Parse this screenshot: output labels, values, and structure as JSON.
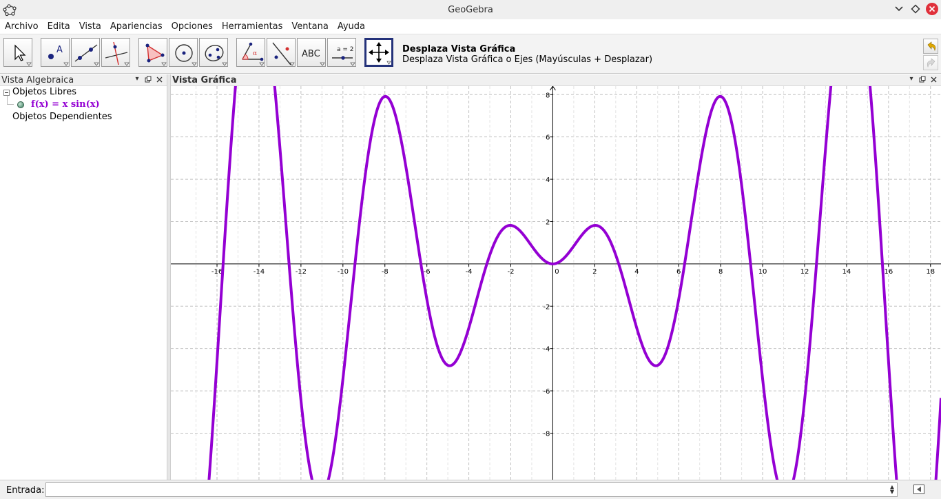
{
  "window": {
    "title": "GeoGebra"
  },
  "menu": [
    {
      "label": "Archivo"
    },
    {
      "label": "Edita"
    },
    {
      "label": "Vista"
    },
    {
      "label": "Apariencias"
    },
    {
      "label": "Opciones"
    },
    {
      "label": "Herramientas"
    },
    {
      "label": "Ventana"
    },
    {
      "label": "Ayuda"
    }
  ],
  "toolbar": {
    "tools": [
      {
        "name": "move-tool",
        "icon": "arrow-pointer-icon"
      },
      {
        "name": "point-tool",
        "icon": "point-icon"
      },
      {
        "name": "line-tool",
        "icon": "line-icon"
      },
      {
        "name": "perpendicular-tool",
        "icon": "perpendicular-icon"
      },
      {
        "name": "polygon-tool",
        "icon": "polygon-icon"
      },
      {
        "name": "circle-tool",
        "icon": "circle-icon"
      },
      {
        "name": "ellipse-tool",
        "icon": "ellipse-icon"
      },
      {
        "name": "angle-tool",
        "icon": "angle-icon"
      },
      {
        "name": "reflect-tool",
        "icon": "reflect-icon"
      },
      {
        "name": "text-tool",
        "icon": "text-icon",
        "label": "ABC"
      },
      {
        "name": "slider-tool",
        "icon": "slider-icon",
        "label": "a = 2"
      },
      {
        "name": "move-graphics-view-tool",
        "icon": "move-view-icon",
        "active": true
      }
    ],
    "active_tool_title": "Desplaza Vista Gráfica",
    "active_tool_desc": "Desplaza Vista Gráfica o Ejes (Mayúsculas + Desplazar)"
  },
  "algebra_view": {
    "title": "Vista Algebraica",
    "free_objects_label": "Objetos Libres",
    "function_text": "f(x)  =  x  sin(x)",
    "dependent_objects_label": "Objetos Dependientes"
  },
  "graphics_view": {
    "title": "Vista Gráfica"
  },
  "input_bar": {
    "label": "Entrada:",
    "value": ""
  },
  "colors": {
    "function": "#9400d3",
    "active_tool_border": "#24327a",
    "close_button": "#e0303b"
  },
  "chart_data": {
    "type": "line",
    "function": "x*sin(x)",
    "xlim": [
      -18.2,
      18.5
    ],
    "ylim": [
      -10.2,
      8.4
    ],
    "x_ticks": [
      -16,
      -14,
      -12,
      -10,
      -8,
      -6,
      -4,
      -2,
      0,
      2,
      4,
      6,
      8,
      10,
      12,
      14,
      16,
      18
    ],
    "y_ticks": [
      -8,
      -6,
      -4,
      -2,
      0,
      2,
      4,
      6,
      8
    ],
    "grid": true,
    "series": [
      {
        "color": "#9400d3"
      }
    ]
  }
}
